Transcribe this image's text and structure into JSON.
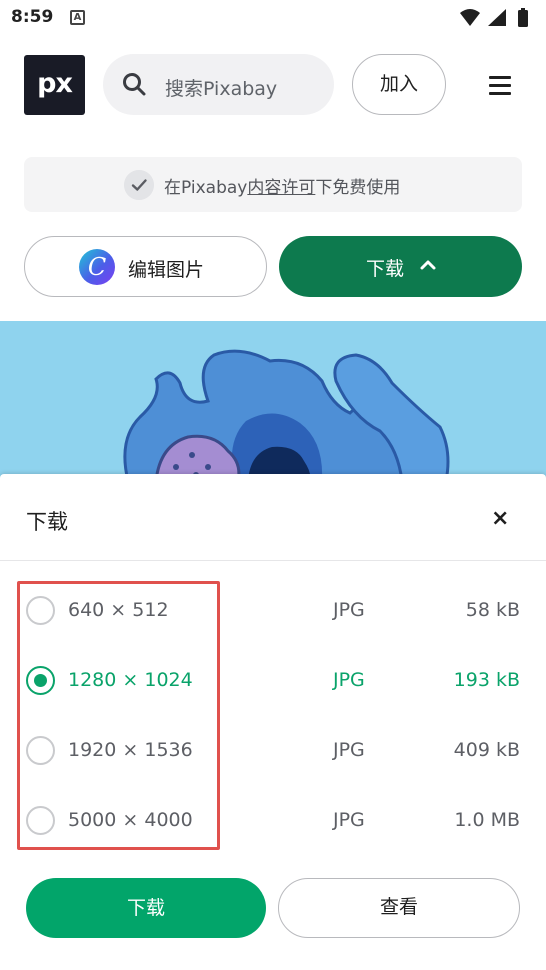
{
  "status_bar": {
    "time": "8:59",
    "notification_icon": "A"
  },
  "header": {
    "logo_text": "px",
    "search_placeholder": "搜索Pixabay",
    "join_label": "加入"
  },
  "license": {
    "prefix": "在Pixabay",
    "link": "内容许可",
    "suffix": "下免费使用"
  },
  "actions": {
    "edit_label": "编辑图片",
    "canva_letter": "C",
    "download_label": "下载"
  },
  "download_sheet": {
    "title": "下载",
    "close_symbol": "×",
    "options": [
      {
        "resolution": "640 × 512",
        "format": "JPG",
        "size": "58 kB",
        "selected": false
      },
      {
        "resolution": "1280 × 1024",
        "format": "JPG",
        "size": "193 kB",
        "selected": true
      },
      {
        "resolution": "1920 × 1536",
        "format": "JPG",
        "size": "409 kB",
        "selected": false
      },
      {
        "resolution": "5000 × 4000",
        "format": "JPG",
        "size": "1.0 MB",
        "selected": false
      }
    ],
    "download_button": "下载",
    "view_button": "查看"
  },
  "colors": {
    "brand_green": "#0d7a4e",
    "accent_green": "#0aa36a",
    "highlight_red": "#e0514d",
    "logo_bg": "#191b26",
    "preview_sky": "#8fd3ee"
  }
}
